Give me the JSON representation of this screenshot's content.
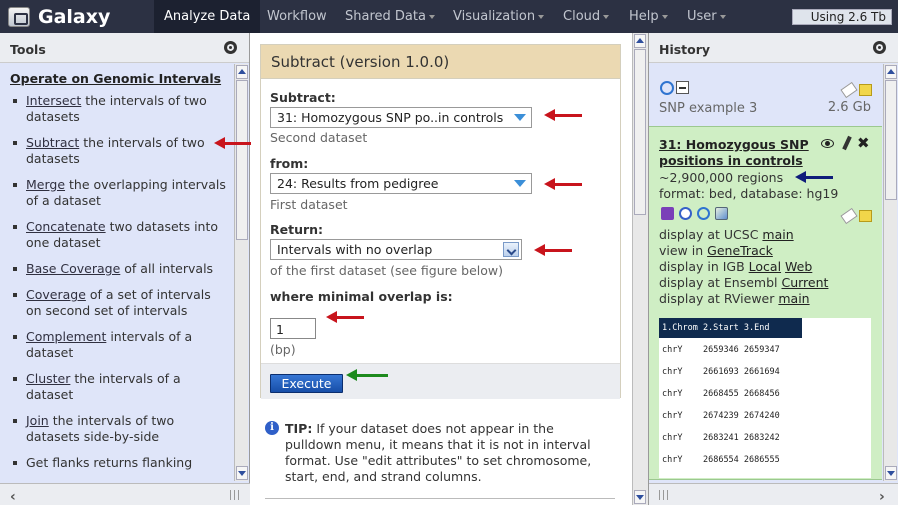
{
  "masthead": {
    "brand": "Galaxy",
    "tabs": [
      {
        "label": "Analyze Data",
        "active": true,
        "dropdown": false
      },
      {
        "label": "Workflow",
        "active": false,
        "dropdown": false
      },
      {
        "label": "Shared Data",
        "active": false,
        "dropdown": true
      },
      {
        "label": "Visualization",
        "active": false,
        "dropdown": true
      },
      {
        "label": "Cloud",
        "active": false,
        "dropdown": true
      },
      {
        "label": "Help",
        "active": false,
        "dropdown": true
      },
      {
        "label": "User",
        "active": false,
        "dropdown": true
      }
    ],
    "usage": "Using 2.6 Tb"
  },
  "tools": {
    "title": "Tools",
    "section": "Operate on Genomic Intervals",
    "items": [
      {
        "link": "Intersect",
        "text": " the intervals of two datasets"
      },
      {
        "link": "Subtract",
        "text": " the intervals of two datasets"
      },
      {
        "link": "Merge",
        "text": " the overlapping intervals of a dataset"
      },
      {
        "link": "Concatenate",
        "text": " two datasets into one dataset"
      },
      {
        "link": "Base Coverage",
        "text": " of all intervals"
      },
      {
        "link": "Coverage",
        "text": " of a set of intervals on second set of intervals"
      },
      {
        "link": "Complement",
        "text": " intervals of a dataset"
      },
      {
        "link": "Cluster",
        "text": " the intervals of a dataset"
      },
      {
        "link": "Join",
        "text": " the intervals of two datasets side-by-side"
      },
      {
        "link": "",
        "text": "Get flanks returns flanking"
      }
    ]
  },
  "form": {
    "title": "Subtract (version 1.0.0)",
    "subtract_label": "Subtract:",
    "subtract_value": "31: Homozygous SNP po..in controls",
    "subtract_help": "Second dataset",
    "from_label": "from:",
    "from_value": "24: Results from pedigree",
    "from_help": "First dataset",
    "return_label": "Return:",
    "return_value": "Intervals with no overlap",
    "return_help": "of the first dataset (see figure below)",
    "overlap_label": "where minimal overlap is:",
    "overlap_value": "1",
    "overlap_help": "(bp)",
    "execute": "Execute",
    "tip_bold": "TIP:",
    "tip_text": " If your dataset does not appear in the pulldown menu, it means that it is not in interval format. Use \"edit attributes\" to set chromosome, start, end, and strand columns."
  },
  "history": {
    "title": "History",
    "name": "SNP example 3",
    "size": "2.6 Gb",
    "dataset": {
      "title": "31: Homozygous SNP positions in controls",
      "regions": "~2,900,000 regions",
      "format": "format: bed, database: hg19",
      "links": [
        {
          "prefix": "display at UCSC ",
          "links": [
            "main"
          ]
        },
        {
          "prefix": "view in ",
          "links": [
            "GeneTrack"
          ]
        },
        {
          "prefix": "display in IGB ",
          "links": [
            "Local",
            "Web"
          ]
        },
        {
          "prefix": "display at Ensembl ",
          "links": [
            "Current"
          ]
        },
        {
          "prefix": "display at RViewer ",
          "links": [
            "main"
          ]
        }
      ],
      "peek_header": "1.Chrom 2.Start 3.End",
      "peek_rows": [
        [
          "chrY",
          "2659346",
          "2659347"
        ],
        [
          "chrY",
          "2661693",
          "2661694"
        ],
        [
          "chrY",
          "2668455",
          "2668456"
        ],
        [
          "chrY",
          "2674239",
          "2674240"
        ],
        [
          "chrY",
          "2683241",
          "2683242"
        ],
        [
          "chrY",
          "2686554",
          "2686555"
        ]
      ]
    }
  },
  "colors": {
    "masthead": "#2c3143",
    "panel_bg": "#dfe5f9",
    "form_title_bg": "#ebd9b2",
    "dataset_ok": "#cfeec4",
    "execute": "#1f5fbf",
    "red_arrow": "#c8141c",
    "green_arrow": "#1d8a1d",
    "blue_arrow": "#0f1c7a"
  }
}
